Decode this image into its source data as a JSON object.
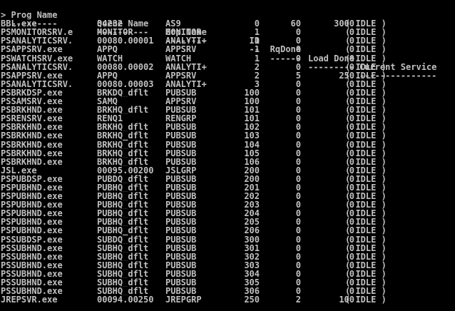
{
  "prompt": "> ",
  "headers": {
    "prog": "Prog Name",
    "queue": "Queue Name",
    "grp": "Grp Name",
    "id": "ID",
    "rq": "RqDone",
    "load": "Load Done",
    "state": "Current Service"
  },
  "dashes": {
    "prog": "---------",
    "queue": "----------",
    "grp": "--------",
    "id": "--",
    "rq": "------",
    "load": "---------",
    "state": "---------------"
  },
  "rows": [
    {
      "prog": "BBL.exe",
      "queue": "34232",
      "grp": "AS9",
      "id": "0",
      "rq": "60",
      "load": "3000",
      "state": "IDLE"
    },
    {
      "prog": "PSMONITORSRV.e",
      "queue": "MONITOR",
      "grp": "MONITOR",
      "id": "1",
      "rq": "0",
      "load": "0",
      "state": "IDLE"
    },
    {
      "prog": "PSANALYTICSRV.",
      "queue": "00080.00001",
      "grp": "ANALYTI+",
      "id": "1",
      "rq": "0",
      "load": "0",
      "state": "IDLE"
    },
    {
      "prog": "PSAPPSRV.exe",
      "queue": "APPQ",
      "grp": "APPSRV",
      "id": "1",
      "rq": "0",
      "load": "0",
      "state": "IDLE"
    },
    {
      "prog": "PSWATCHSRV.exe",
      "queue": "WATCH",
      "grp": "WATCH",
      "id": "1",
      "rq": "0",
      "load": "0",
      "state": "IDLE"
    },
    {
      "prog": "PSANALYTICSRV.",
      "queue": "00080.00002",
      "grp": "ANALYTI+",
      "id": "2",
      "rq": "0",
      "load": "0",
      "state": "IDLE"
    },
    {
      "prog": "PSAPPSRV.exe",
      "queue": "APPQ",
      "grp": "APPSRV",
      "id": "2",
      "rq": "5",
      "load": "250",
      "state": "IDLE"
    },
    {
      "prog": "PSANALYTICSRV.",
      "queue": "00080.00003",
      "grp": "ANALYTI+",
      "id": "3",
      "rq": "0",
      "load": "0",
      "state": "IDLE"
    },
    {
      "prog": "PSBRKDSP.exe",
      "queue": "BRKDQ_dflt",
      "grp": "PUBSUB",
      "id": "100",
      "rq": "0",
      "load": "0",
      "state": "IDLE"
    },
    {
      "prog": "PSSAMSRV.exe",
      "queue": "SAMQ",
      "grp": "APPSRV",
      "id": "100",
      "rq": "0",
      "load": "0",
      "state": "IDLE"
    },
    {
      "prog": "PSBRKHND.exe",
      "queue": "BRKHQ_dflt",
      "grp": "PUBSUB",
      "id": "101",
      "rq": "0",
      "load": "0",
      "state": "IDLE"
    },
    {
      "prog": "PSRENSRV.exe",
      "queue": "RENQ1",
      "grp": "RENGRP",
      "id": "101",
      "rq": "0",
      "load": "0",
      "state": "IDLE"
    },
    {
      "prog": "PSBRKHND.exe",
      "queue": "BRKHQ_dflt",
      "grp": "PUBSUB",
      "id": "102",
      "rq": "0",
      "load": "0",
      "state": "IDLE"
    },
    {
      "prog": "PSBRKHND.exe",
      "queue": "BRKHQ_dflt",
      "grp": "PUBSUB",
      "id": "103",
      "rq": "0",
      "load": "0",
      "state": "IDLE"
    },
    {
      "prog": "PSBRKHND.exe",
      "queue": "BRKHQ_dflt",
      "grp": "PUBSUB",
      "id": "104",
      "rq": "0",
      "load": "0",
      "state": "IDLE"
    },
    {
      "prog": "PSBRKHND.exe",
      "queue": "BRKHQ_dflt",
      "grp": "PUBSUB",
      "id": "105",
      "rq": "0",
      "load": "0",
      "state": "IDLE"
    },
    {
      "prog": "PSBRKHND.exe",
      "queue": "BRKHQ_dflt",
      "grp": "PUBSUB",
      "id": "106",
      "rq": "0",
      "load": "0",
      "state": "IDLE"
    },
    {
      "prog": "JSL.exe",
      "queue": "00095.00200",
      "grp": "JSLGRP",
      "id": "200",
      "rq": "0",
      "load": "0",
      "state": "IDLE"
    },
    {
      "prog": "PSPUBDSP.exe",
      "queue": "PUBDQ_dflt",
      "grp": "PUBSUB",
      "id": "200",
      "rq": "0",
      "load": "0",
      "state": "IDLE"
    },
    {
      "prog": "PSPUBHND.exe",
      "queue": "PUBHQ_dflt",
      "grp": "PUBSUB",
      "id": "201",
      "rq": "0",
      "load": "0",
      "state": "IDLE"
    },
    {
      "prog": "PSPUBHND.exe",
      "queue": "PUBHQ_dflt",
      "grp": "PUBSUB",
      "id": "202",
      "rq": "0",
      "load": "0",
      "state": "IDLE"
    },
    {
      "prog": "PSPUBHND.exe",
      "queue": "PUBHQ_dflt",
      "grp": "PUBSUB",
      "id": "203",
      "rq": "0",
      "load": "0",
      "state": "IDLE"
    },
    {
      "prog": "PSPUBHND.exe",
      "queue": "PUBHQ_dflt",
      "grp": "PUBSUB",
      "id": "204",
      "rq": "0",
      "load": "0",
      "state": "IDLE"
    },
    {
      "prog": "PSPUBHND.exe",
      "queue": "PUBHQ_dflt",
      "grp": "PUBSUB",
      "id": "205",
      "rq": "0",
      "load": "0",
      "state": "IDLE"
    },
    {
      "prog": "PSPUBHND.exe",
      "queue": "PUBHQ_dflt",
      "grp": "PUBSUB",
      "id": "206",
      "rq": "0",
      "load": "0",
      "state": "IDLE"
    },
    {
      "prog": "PSSUBDSP.exe",
      "queue": "SUBDQ_dflt",
      "grp": "PUBSUB",
      "id": "300",
      "rq": "0",
      "load": "0",
      "state": "IDLE"
    },
    {
      "prog": "PSSUBHND.exe",
      "queue": "SUBHQ_dflt",
      "grp": "PUBSUB",
      "id": "301",
      "rq": "0",
      "load": "0",
      "state": "IDLE"
    },
    {
      "prog": "PSSUBHND.exe",
      "queue": "SUBHQ_dflt",
      "grp": "PUBSUB",
      "id": "302",
      "rq": "0",
      "load": "0",
      "state": "IDLE"
    },
    {
      "prog": "PSSUBHND.exe",
      "queue": "SUBHQ_dflt",
      "grp": "PUBSUB",
      "id": "303",
      "rq": "0",
      "load": "0",
      "state": "IDLE"
    },
    {
      "prog": "PSSUBHND.exe",
      "queue": "SUBHQ_dflt",
      "grp": "PUBSUB",
      "id": "304",
      "rq": "0",
      "load": "0",
      "state": "IDLE"
    },
    {
      "prog": "PSSUBHND.exe",
      "queue": "SUBHQ_dflt",
      "grp": "PUBSUB",
      "id": "305",
      "rq": "0",
      "load": "0",
      "state": "IDLE"
    },
    {
      "prog": "PSSUBHND.exe",
      "queue": "SUBHQ_dflt",
      "grp": "PUBSUB",
      "id": "306",
      "rq": "0",
      "load": "0",
      "state": "IDLE"
    },
    {
      "prog": "JREPSVR.exe",
      "queue": "00094.00250",
      "grp": "JREPGRP",
      "id": "250",
      "rq": "2",
      "load": "100",
      "state": "IDLE"
    }
  ],
  "colors": {
    "background": "#000000",
    "text": "#c0c0c0"
  }
}
